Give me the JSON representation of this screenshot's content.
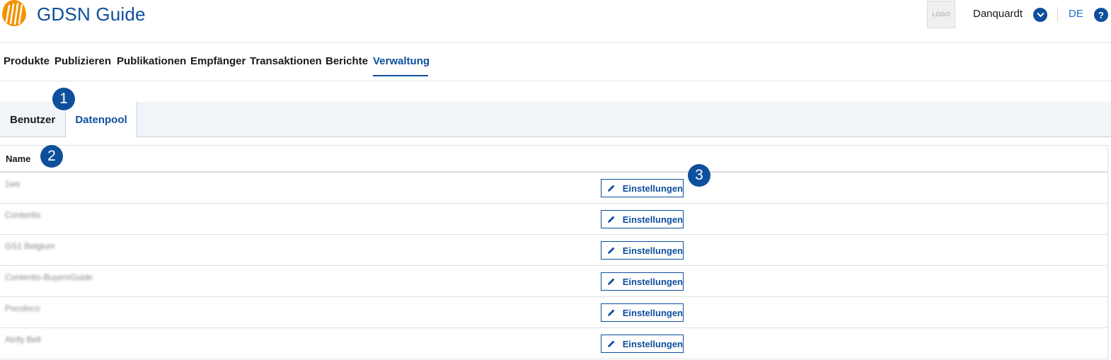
{
  "header": {
    "app_title": "GDSN Guide",
    "logo_placeholder": "LOGO",
    "user_name": "Danquardt",
    "language": "DE",
    "help_icon": "question-icon",
    "user_menu_icon": "chevron-down-icon",
    "brand_color": "#0d4f9c",
    "brand_logo_color": "#f39200"
  },
  "main_nav": {
    "items": [
      {
        "label": "Produkte"
      },
      {
        "label": "Publizieren"
      },
      {
        "label": "Publikationen"
      },
      {
        "label": "Empfänger"
      },
      {
        "label": "Transaktionen"
      },
      {
        "label": "Berichte"
      },
      {
        "label": "Verwaltung",
        "active": true
      }
    ]
  },
  "tabs": [
    {
      "label": "Benutzer",
      "active": false
    },
    {
      "label": "Datenpool",
      "active": true
    }
  ],
  "table": {
    "header_name": "Name",
    "rows": [
      {
        "name": "1ws",
        "action": "Einstellungen"
      },
      {
        "name": "Contentis",
        "action": "Einstellungen"
      },
      {
        "name": "GS1 Belgium",
        "action": "Einstellungen"
      },
      {
        "name": "Contentis-BuyersGuide",
        "action": "Einstellungen"
      },
      {
        "name": "Pocoloco",
        "action": "Einstellungen"
      },
      {
        "name": "Atrify Bell",
        "action": "Einstellungen"
      }
    ]
  },
  "callouts": [
    "1",
    "2",
    "3"
  ]
}
